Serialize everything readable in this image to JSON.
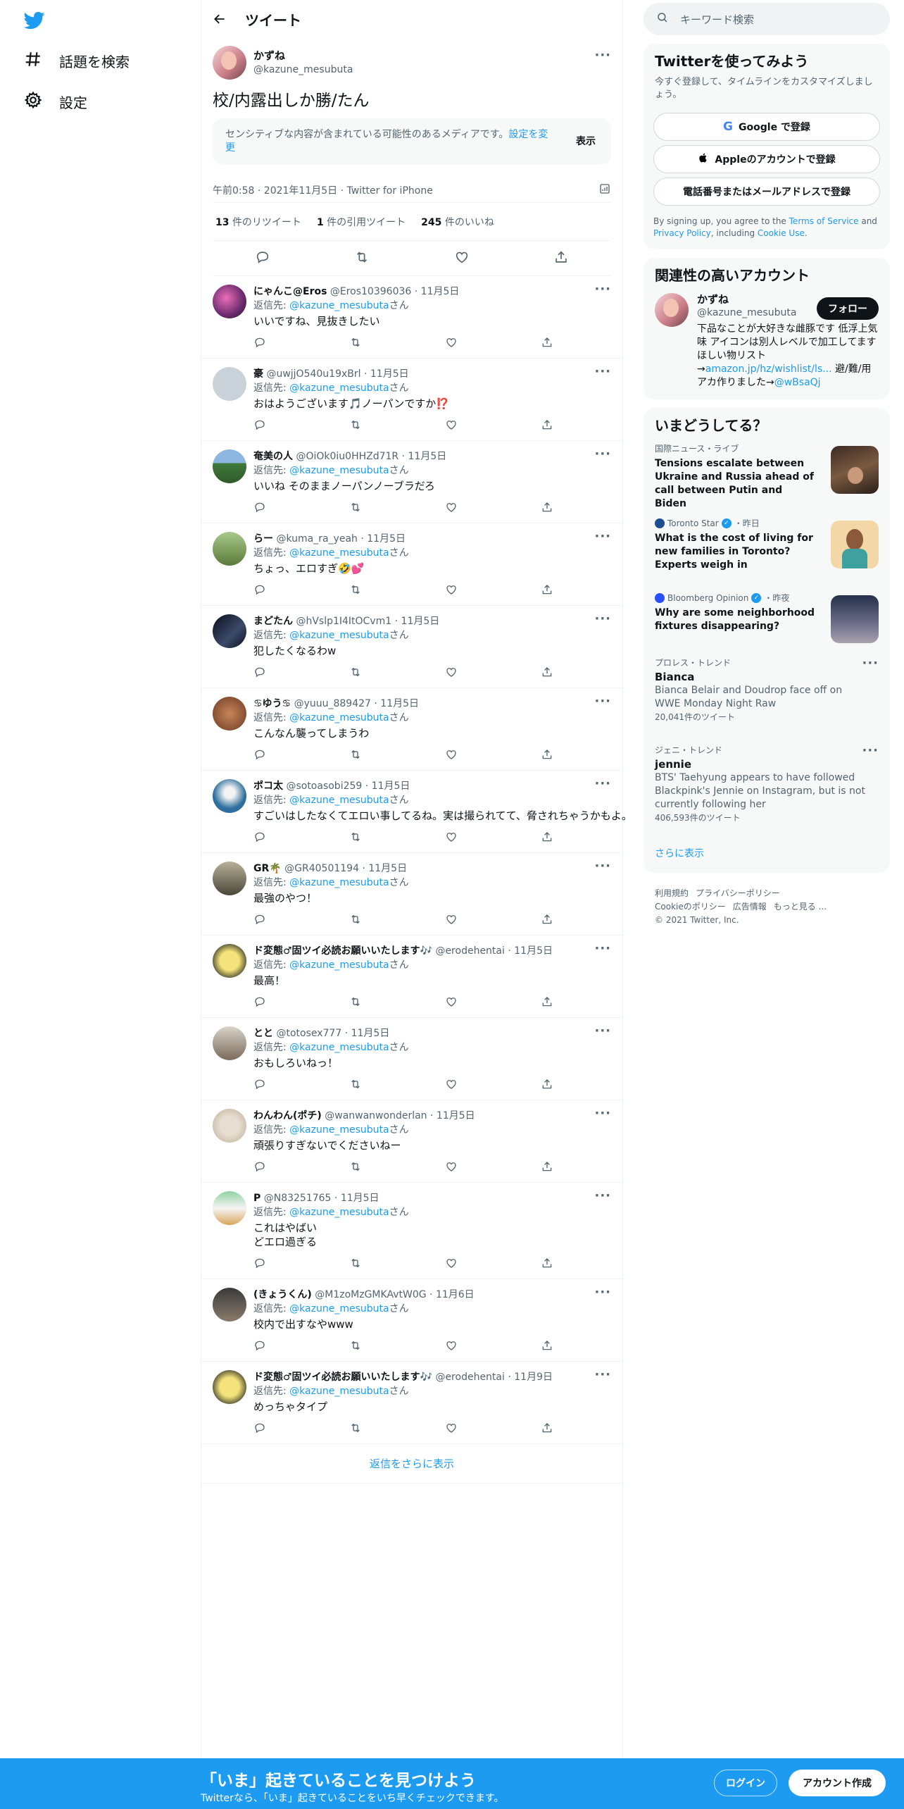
{
  "colors": {
    "accent": "#1d9bf0",
    "text": "#0f1419",
    "muted": "#536471",
    "banner": "#1d9bf0"
  },
  "nav": {
    "logo_icon": "twitter-bird-icon",
    "explore_label": "話題を検索",
    "settings_label": "設定"
  },
  "header": {
    "title": "ツイート"
  },
  "tweet": {
    "name": "かずね",
    "handle": "@kazune_mesubuta",
    "text": "校/内露出しか勝/たん",
    "sensitive_text": "センシティブな内容が含まれている可能性のあるメディアです。",
    "sensitive_link": "設定を変更",
    "show_label": "表示",
    "timestamp": "午前0:58 · 2021年11月5日 · Twitter for iPhone",
    "retweets": "13",
    "retweets_label": "件のリツイート",
    "quotes": "1",
    "quotes_label": "件の引用ツイート",
    "likes": "245",
    "likes_label": "件のいいね"
  },
  "reply_prefix": "返信先: ",
  "reply_to": "@kazune_mesubuta",
  "reply_suffix": "さん",
  "replies": [
    {
      "name": "にゃんこ@Eros",
      "handle": "@Eros10396036",
      "date": "11月5日",
      "text": "いいですね、見抜きしたい"
    },
    {
      "name": "豪",
      "handle": "@uwjjO540u19xBrl",
      "date": "11月5日",
      "text": "おはようございます🎵ノーパンですか⁉️"
    },
    {
      "name": "奄美の人",
      "handle": "@OiOk0iu0HHZd71R",
      "date": "11月5日",
      "text": "いいね そのままノーパンノーブラだろ"
    },
    {
      "name": "らー",
      "handle": "@kuma_ra_yeah",
      "date": "11月5日",
      "text": "ちょっ、エロすぎ🤣💕"
    },
    {
      "name": "まどたん",
      "handle": "@hVslp1I4ItOCvm1",
      "date": "11月5日",
      "text": "犯したくなるわw"
    },
    {
      "name": "♋ゆう♋",
      "handle": "@yuuu_889427",
      "date": "11月5日",
      "text": "こんなん襲ってしまうわ"
    },
    {
      "name": "ポコ太",
      "handle": "@sotoasobi259",
      "date": "11月5日",
      "text": "すごいはしたなくてエロい事してるね。実は撮られてて、脅されちゃうかもよ。"
    },
    {
      "name": "GR🌴",
      "handle": "@GR40501194",
      "date": "11月5日",
      "text": "最強のやつ！"
    },
    {
      "name": "ド変態♂固ツイ必読お願いいたします🎶",
      "handle": "@erodehentai",
      "date": "11月5日",
      "text": "最高！"
    },
    {
      "name": "とと",
      "handle": "@totosex777",
      "date": "11月5日",
      "text": "おもしろいねっ！"
    },
    {
      "name": "わんわん(ポチ)",
      "handle": "@wanwanwonderlan",
      "date": "11月5日",
      "text": "頑張りすぎないでくださいねー"
    },
    {
      "name": "P",
      "handle": "@N83251765",
      "date": "11月5日",
      "text": "これはやばい\nどエロ過ぎる"
    },
    {
      "name": "(きょうくん)",
      "handle": "@M1zoMzGMKAvtW0G",
      "date": "11月6日",
      "text": "校内で出すなやwww"
    },
    {
      "name": "ド変態♂固ツイ必読お願いいたします🎶",
      "handle": "@erodehentai",
      "date": "11月9日",
      "text": "めっちゃタイプ"
    }
  ],
  "more_replies_label": "返信をさらに表示",
  "search": {
    "placeholder": "キーワード検索"
  },
  "signup": {
    "title": "Twitterを使ってみよう",
    "subtitle": "今すぐ登録して、タイムラインをカスタマイズしましょう。",
    "google": "Google で登録",
    "apple": "Appleのアカウントで登録",
    "phone": "電話番号またはメールアドレスで登録",
    "terms_pre": "By signing up, you agree to the ",
    "terms_tos": "Terms of Service",
    "terms_and": " and ",
    "terms_privacy": "Privacy Policy",
    "terms_incl": ", including ",
    "terms_cookie": "Cookie Use",
    "terms_end": "."
  },
  "relevant": {
    "title": "関連性の高いアカウント",
    "name": "かずね",
    "handle": "@kazune_mesubuta",
    "follow": "フォロー",
    "bio_1": "下品なことが大好きな雌豚です 低浮上気味 アイコンは別人レベルで加工してます ほしい物リスト→",
    "bio_link": "amazon.jp/hz/wishlist/ls...",
    "bio_2": " 避/難/用アカ作りました→",
    "bio_link2": "@wBsaQj"
  },
  "trends": {
    "title": "いまどうしてる？",
    "news": [
      {
        "source": "国際ニュース・ライブ",
        "headline": "Tensions escalate between Ukraine and Russia ahead of call between Putin and Biden"
      },
      {
        "source": "Toronto Star",
        "when": "・昨日",
        "headline": "What is the cost of living for new families in Toronto? Experts weigh in"
      },
      {
        "source": "Bloomberg Opinion",
        "when": "・昨夜",
        "headline": "Why are some neighborhood fixtures disappearing?"
      }
    ],
    "items": [
      {
        "category": "プロレス・トレンド",
        "name": "Bianca",
        "desc": "Bianca Belair and Doudrop face off on WWE Monday Night Raw",
        "count": "20,041件のツイート"
      },
      {
        "category": "ジェニ・トレンド",
        "name": "jennie",
        "desc": "BTS' Taehyung appears to have followed Blackpink's Jennie on Instagram, but is not currently following her",
        "count": "406,593件のツイート"
      }
    ],
    "show_more": "さらに表示"
  },
  "footer": {
    "terms": "利用規約",
    "privacy": "プライバシーポリシー",
    "cookie": "Cookieのポリシー",
    "ads": "広告情報",
    "more": "もっと見る ...",
    "copyright": "© 2021 Twitter, Inc."
  },
  "banner": {
    "headline": "「いま」起きていることを見つけよう",
    "sub": "Twitterなら、「いま」起きていることをいち早くチェックできます。",
    "login": "ログイン",
    "signup": "アカウント作成"
  }
}
